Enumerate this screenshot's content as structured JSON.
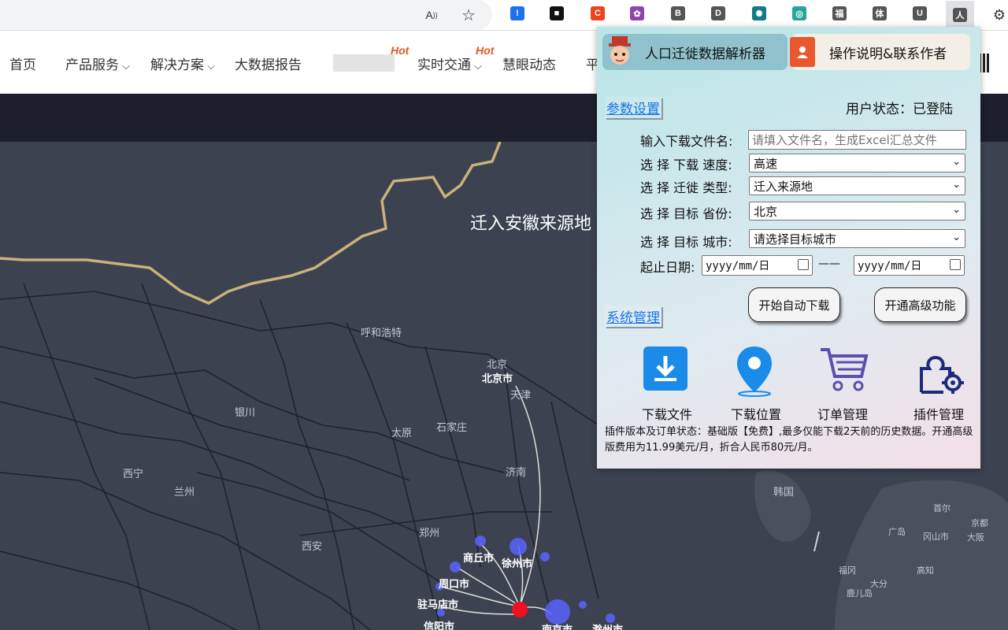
{
  "browser": {
    "read_aloud_icon": "read-aloud-icon",
    "favorite_icon": "star-icon",
    "extensions": [
      {
        "name": "ext-shield-alert",
        "glyph": "!",
        "color": "#1a73e8"
      },
      {
        "name": "ext-black",
        "glyph": "■",
        "color": "#111111"
      },
      {
        "name": "ext-c",
        "glyph": "C",
        "color": "#e8471c"
      },
      {
        "name": "ext-brain",
        "glyph": "✿",
        "color": "#8e44ad"
      },
      {
        "name": "ext-b",
        "glyph": "B",
        "color": "#555555"
      },
      {
        "name": "ext-d",
        "glyph": "D",
        "color": "#555555"
      },
      {
        "name": "ext-openai",
        "glyph": "✺",
        "color": "#117a8b"
      },
      {
        "name": "ext-teal",
        "glyph": "◎",
        "color": "#26a69a"
      },
      {
        "name": "ext-fu",
        "glyph": "福",
        "color": "#555555"
      },
      {
        "name": "ext-ti",
        "glyph": "体",
        "color": "#555555"
      },
      {
        "name": "ext-u",
        "glyph": "U",
        "color": "#555555"
      },
      {
        "name": "ext-ren",
        "glyph": "人",
        "color": "#555555"
      }
    ]
  },
  "site": {
    "nav": [
      "首页",
      "产品服务",
      "解决方案",
      "大数据报告",
      "实时交通",
      "慧眼动态",
      "平"
    ],
    "hot_label": "Hot"
  },
  "map": {
    "title": "迁入安徽来源地",
    "cities": [
      "呼和浩特",
      "北京",
      "北京市",
      "天津",
      "银川",
      "太原",
      "石家庄",
      "西宁",
      "兰州",
      "济南",
      "郑州",
      "西安",
      "韩国",
      "首尔",
      "广岛",
      "冈山市",
      "福冈",
      "大分",
      "高知",
      "鹿儿岛",
      "京都",
      "大阪"
    ],
    "bold_cities": [
      "商丘市",
      "徐州市",
      "周口市",
      "驻马店市",
      "信阳市",
      "南京市",
      "滁州市"
    ]
  },
  "popup": {
    "tab_main": "人口迁徙数据解析器",
    "tab_help": "操作说明&联系作者",
    "section_params": "参数设置",
    "user_status": "用户状态：已登陆",
    "filename_label": "输入下载文件名:",
    "filename_placeholder": "请填入文件名，生成Excel汇总文件",
    "speed_label": "选 择 下载 速度:",
    "speed_value": "高速",
    "type_label": "选 择 迁徙 类型:",
    "type_value": "迁入来源地",
    "province_label": "选 择 目标 省份:",
    "province_value": "北京",
    "city_label": "选 择 目标 城市:",
    "city_value": "请选择目标城市",
    "date_label": "起止日期:",
    "date_placeholder": "yyyy/mm/日",
    "date_sep": "——",
    "start_btn": "开始自动下载",
    "advanced_btn": "开通高级功能",
    "section_system": "系统管理",
    "tools": [
      "下载文件",
      "下载位置",
      "订单管理",
      "插件管理"
    ],
    "note": "插件版本及订单状态：基础版【免费】,最多仅能下载2天前的历史数据。开通高级版费用为11.99美元/月，折合人民币80元/月。"
  },
  "colors": {
    "accent_blue": "#1a73e8",
    "map_bg": "#3c4250",
    "hot_orange": "#e8541c",
    "border_yellow": "#c9b27a"
  }
}
